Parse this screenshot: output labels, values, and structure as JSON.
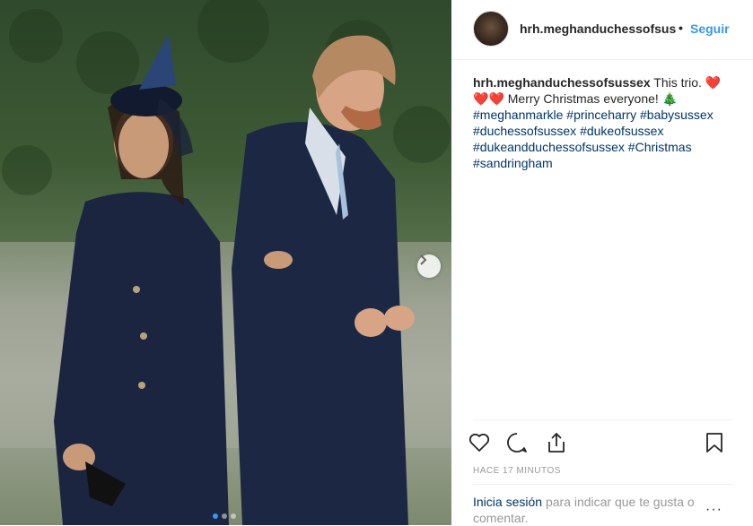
{
  "post": {
    "carousel": {
      "count": 3,
      "active": 1
    }
  },
  "header": {
    "username": "hrh.meghanduchessofsus",
    "separator": "•",
    "follow_label": "Seguir"
  },
  "caption": {
    "username": "hrh.meghanduchessofsussex",
    "text1": "This trio.",
    "text2": "Merry Christmas everyone!",
    "hearts_emoji": "❤️",
    "tree_emoji": "🎄",
    "hashtags": [
      "#meghanmarkle",
      "#princeharry",
      "#babysussex",
      "#duchessofsussex",
      "#dukeofsussex",
      "#dukeandduchessofsussex",
      "#Christmas",
      "#sandringham"
    ]
  },
  "actions": {
    "like_icon": "heart-outline-icon",
    "comment_icon": "comment-icon",
    "share_icon": "share-icon",
    "save_icon": "bookmark-icon"
  },
  "timestamp": "HACE 17 MINUTOS",
  "login_prompt": {
    "link": "Inicia sesión",
    "rest": "para indicar que te gusta o comentar.",
    "more": "···"
  },
  "colors": {
    "link": "#3897f0",
    "hashtag": "#003569",
    "heart": "#ed1c24"
  }
}
